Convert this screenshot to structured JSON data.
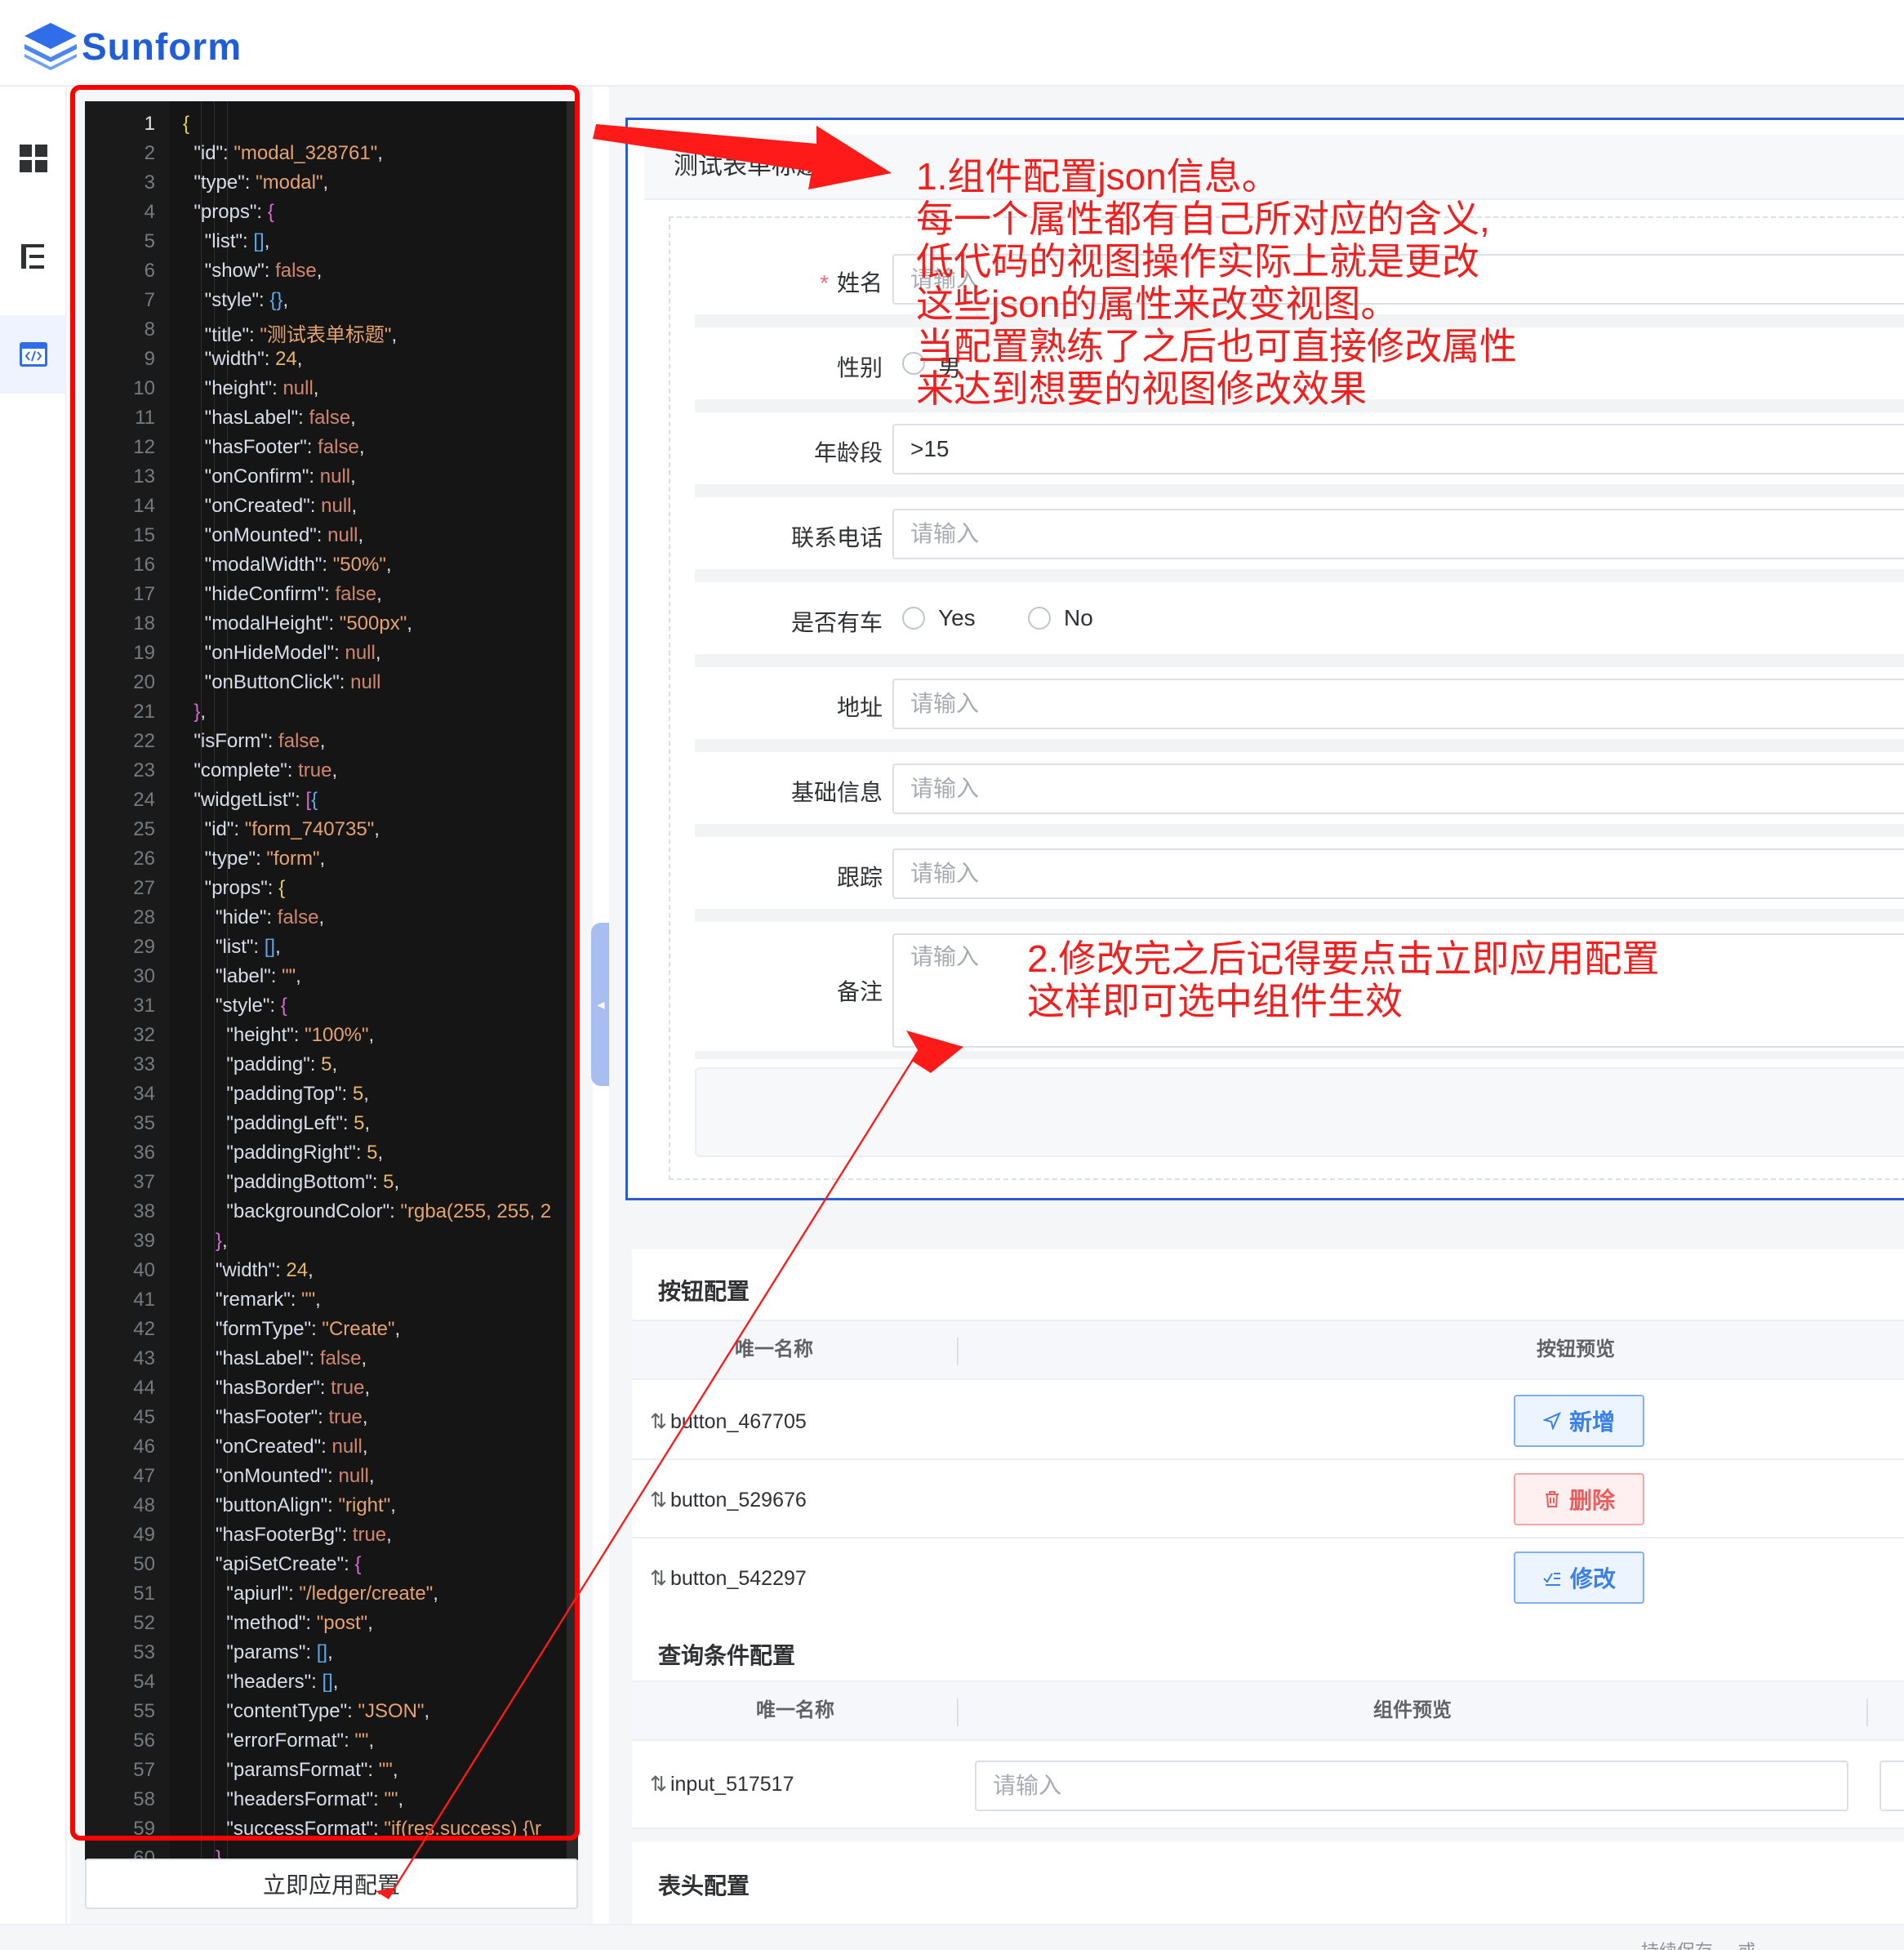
{
  "brand": {
    "name": "Sunform",
    "logo_icon": "layers-icon",
    "color": "#1f5ed8"
  },
  "nav": {
    "items": [
      {
        "icon": "dashboard-grid-icon",
        "active": false
      },
      {
        "icon": "tree-list-icon",
        "active": false
      },
      {
        "icon": "code-window-icon",
        "active": true
      }
    ]
  },
  "editor": {
    "apply_button": "立即应用配置",
    "current_line": 1,
    "lines": [
      [
        [
          "p1",
          "{"
        ]
      ],
      [
        [
          "k",
          "  \"id\": "
        ],
        [
          "s",
          "\"modal_328761\""
        ],
        [
          "k",
          ","
        ]
      ],
      [
        [
          "k",
          "  \"type\": "
        ],
        [
          "s",
          "\"modal\""
        ],
        [
          "k",
          ","
        ]
      ],
      [
        [
          "k",
          "  \"props\": "
        ],
        [
          "p2",
          "{"
        ]
      ],
      [
        [
          "k",
          "    \"list\": "
        ],
        [
          "p3",
          "[]"
        ],
        [
          "k",
          ","
        ]
      ],
      [
        [
          "k",
          "    \"show\": "
        ],
        [
          "b",
          "false"
        ],
        [
          "k",
          ","
        ]
      ],
      [
        [
          "k",
          "    \"style\": "
        ],
        [
          "p3",
          "{}"
        ],
        [
          "k",
          ","
        ]
      ],
      [
        [
          "k",
          "    \"title\": "
        ],
        [
          "s",
          "\"测试表单标题\""
        ],
        [
          "k",
          ","
        ]
      ],
      [
        [
          "k",
          "    \"width\": "
        ],
        [
          "n",
          "24"
        ],
        [
          "k",
          ","
        ]
      ],
      [
        [
          "k",
          "    \"height\": "
        ],
        [
          "b",
          "null"
        ],
        [
          "k",
          ","
        ]
      ],
      [
        [
          "k",
          "    \"hasLabel\": "
        ],
        [
          "b",
          "false"
        ],
        [
          "k",
          ","
        ]
      ],
      [
        [
          "k",
          "    \"hasFooter\": "
        ],
        [
          "b",
          "false"
        ],
        [
          "k",
          ","
        ]
      ],
      [
        [
          "k",
          "    \"onConfirm\": "
        ],
        [
          "b",
          "null"
        ],
        [
          "k",
          ","
        ]
      ],
      [
        [
          "k",
          "    \"onCreated\": "
        ],
        [
          "b",
          "null"
        ],
        [
          "k",
          ","
        ]
      ],
      [
        [
          "k",
          "    \"onMounted\": "
        ],
        [
          "b",
          "null"
        ],
        [
          "k",
          ","
        ]
      ],
      [
        [
          "k",
          "    \"modalWidth\": "
        ],
        [
          "s",
          "\"50%\""
        ],
        [
          "k",
          ","
        ]
      ],
      [
        [
          "k",
          "    \"hideConfirm\": "
        ],
        [
          "b",
          "false"
        ],
        [
          "k",
          ","
        ]
      ],
      [
        [
          "k",
          "    \"modalHeight\": "
        ],
        [
          "s",
          "\"500px\""
        ],
        [
          "k",
          ","
        ]
      ],
      [
        [
          "k",
          "    \"onHideModel\": "
        ],
        [
          "b",
          "null"
        ],
        [
          "k",
          ","
        ]
      ],
      [
        [
          "k",
          "    \"onButtonClick\": "
        ],
        [
          "b",
          "null"
        ]
      ],
      [
        [
          "p2",
          "  }"
        ],
        [
          "k",
          ","
        ]
      ],
      [
        [
          "k",
          "  \"isForm\": "
        ],
        [
          "b",
          "false"
        ],
        [
          "k",
          ","
        ]
      ],
      [
        [
          "k",
          "  \"complete\": "
        ],
        [
          "b",
          "true"
        ],
        [
          "k",
          ","
        ]
      ],
      [
        [
          "k",
          "  \"widgetList\": "
        ],
        [
          "p2",
          "["
        ],
        [
          "p3",
          "{"
        ]
      ],
      [
        [
          "k",
          "    \"id\": "
        ],
        [
          "s",
          "\"form_740735\""
        ],
        [
          "k",
          ","
        ]
      ],
      [
        [
          "k",
          "    \"type\": "
        ],
        [
          "s",
          "\"form\""
        ],
        [
          "k",
          ","
        ]
      ],
      [
        [
          "k",
          "    \"props\": "
        ],
        [
          "p1",
          "{"
        ]
      ],
      [
        [
          "k",
          "      \"hide\": "
        ],
        [
          "b",
          "false"
        ],
        [
          "k",
          ","
        ]
      ],
      [
        [
          "k",
          "      \"list\": "
        ],
        [
          "p3",
          "[]"
        ],
        [
          "k",
          ","
        ]
      ],
      [
        [
          "k",
          "      \"label\": "
        ],
        [
          "s",
          "\"\""
        ],
        [
          "k",
          ","
        ]
      ],
      [
        [
          "k",
          "      \"style\": "
        ],
        [
          "p2",
          "{"
        ]
      ],
      [
        [
          "k",
          "        \"height\": "
        ],
        [
          "s",
          "\"100%\""
        ],
        [
          "k",
          ","
        ]
      ],
      [
        [
          "k",
          "        \"padding\": "
        ],
        [
          "n",
          "5"
        ],
        [
          "k",
          ","
        ]
      ],
      [
        [
          "k",
          "        \"paddingTop\": "
        ],
        [
          "n",
          "5"
        ],
        [
          "k",
          ","
        ]
      ],
      [
        [
          "k",
          "        \"paddingLeft\": "
        ],
        [
          "n",
          "5"
        ],
        [
          "k",
          ","
        ]
      ],
      [
        [
          "k",
          "        \"paddingRight\": "
        ],
        [
          "n",
          "5"
        ],
        [
          "k",
          ","
        ]
      ],
      [
        [
          "k",
          "        \"paddingBottom\": "
        ],
        [
          "n",
          "5"
        ],
        [
          "k",
          ","
        ]
      ],
      [
        [
          "k",
          "        \"backgroundColor\": "
        ],
        [
          "s",
          "\"rgba(255, 255, 2"
        ]
      ],
      [
        [
          "p2",
          "      }"
        ],
        [
          "k",
          ","
        ]
      ],
      [
        [
          "k",
          "      \"width\": "
        ],
        [
          "n",
          "24"
        ],
        [
          "k",
          ","
        ]
      ],
      [
        [
          "k",
          "      \"remark\": "
        ],
        [
          "s",
          "\"\""
        ],
        [
          "k",
          ","
        ]
      ],
      [
        [
          "k",
          "      \"formType\": "
        ],
        [
          "s",
          "\"Create\""
        ],
        [
          "k",
          ","
        ]
      ],
      [
        [
          "k",
          "      \"hasLabel\": "
        ],
        [
          "b",
          "false"
        ],
        [
          "k",
          ","
        ]
      ],
      [
        [
          "k",
          "      \"hasBorder\": "
        ],
        [
          "b",
          "true"
        ],
        [
          "k",
          ","
        ]
      ],
      [
        [
          "k",
          "      \"hasFooter\": "
        ],
        [
          "b",
          "true"
        ],
        [
          "k",
          ","
        ]
      ],
      [
        [
          "k",
          "      \"onCreated\": "
        ],
        [
          "b",
          "null"
        ],
        [
          "k",
          ","
        ]
      ],
      [
        [
          "k",
          "      \"onMounted\": "
        ],
        [
          "b",
          "null"
        ],
        [
          "k",
          ","
        ]
      ],
      [
        [
          "k",
          "      \"buttonAlign\": "
        ],
        [
          "s",
          "\"right\""
        ],
        [
          "k",
          ","
        ]
      ],
      [
        [
          "k",
          "      \"hasFooterBg\": "
        ],
        [
          "b",
          "true"
        ],
        [
          "k",
          ","
        ]
      ],
      [
        [
          "k",
          "      \"apiSetCreate\": "
        ],
        [
          "p2",
          "{"
        ]
      ],
      [
        [
          "k",
          "        \"apiurl\": "
        ],
        [
          "s",
          "\"/ledger/create\""
        ],
        [
          "k",
          ","
        ]
      ],
      [
        [
          "k",
          "        \"method\": "
        ],
        [
          "s",
          "\"post\""
        ],
        [
          "k",
          ","
        ]
      ],
      [
        [
          "k",
          "        \"params\": "
        ],
        [
          "p3",
          "[]"
        ],
        [
          "k",
          ","
        ]
      ],
      [
        [
          "k",
          "        \"headers\": "
        ],
        [
          "p3",
          "[]"
        ],
        [
          "k",
          ","
        ]
      ],
      [
        [
          "k",
          "        \"contentType\": "
        ],
        [
          "s",
          "\"JSON\""
        ],
        [
          "k",
          ","
        ]
      ],
      [
        [
          "k",
          "        \"errorFormat\": "
        ],
        [
          "s",
          "\"\""
        ],
        [
          "k",
          ","
        ]
      ],
      [
        [
          "k",
          "        \"paramsFormat\": "
        ],
        [
          "s",
          "\"\""
        ],
        [
          "k",
          ","
        ]
      ],
      [
        [
          "k",
          "        \"headersFormat\": "
        ],
        [
          "s",
          "\"\""
        ],
        [
          "k",
          ","
        ]
      ],
      [
        [
          "k",
          "        \"successFormat\": "
        ],
        [
          "s",
          "\"if(res.success) {\\r"
        ]
      ],
      [
        [
          "p2",
          "      }"
        ]
      ]
    ]
  },
  "preview": {
    "modal_title": "测试表单标题",
    "fields": [
      {
        "label": "姓名",
        "required": true,
        "kind": "input",
        "placeholder": "请输入",
        "value": ""
      },
      {
        "label": "性别",
        "required": false,
        "kind": "radio",
        "options": [
          "男"
        ]
      },
      {
        "label": "年龄段",
        "required": false,
        "kind": "input",
        "placeholder": "",
        "value": ">15"
      },
      {
        "label": "联系电话",
        "required": false,
        "kind": "input",
        "placeholder": "请输入",
        "value": ""
      },
      {
        "label": "是否有车",
        "required": false,
        "kind": "radio",
        "options": [
          "Yes",
          "No"
        ]
      },
      {
        "label": "地址",
        "required": false,
        "kind": "input",
        "placeholder": "请输入",
        "value": ""
      },
      {
        "label": "基础信息",
        "required": false,
        "kind": "input",
        "placeholder": "请输入",
        "value": ""
      },
      {
        "label": "跟踪",
        "required": false,
        "kind": "input",
        "placeholder": "请输入",
        "value": ""
      },
      {
        "label": "备注",
        "required": false,
        "kind": "textarea",
        "placeholder": "请输入",
        "value": ""
      }
    ]
  },
  "button_config": {
    "title": "按钮配置",
    "headers": [
      "唯一名称",
      "按钮预览"
    ],
    "rows": [
      {
        "name": "button_467705",
        "button": "新增",
        "variant": "blue",
        "icon": "send-icon"
      },
      {
        "name": "button_529676",
        "button": "删除",
        "variant": "red",
        "icon": "trash-icon"
      },
      {
        "name": "button_542297",
        "button": "修改",
        "variant": "blue",
        "icon": "edit-list-icon"
      }
    ]
  },
  "query_config": {
    "title": "查询条件配置",
    "headers": [
      "唯一名称",
      "组件预览"
    ],
    "rows": [
      {
        "name": "input_517517",
        "placeholder": "请输入"
      }
    ]
  },
  "header_config": {
    "title": "表头配置"
  },
  "footer": {
    "text": "持续保存 ... 或"
  },
  "annotations": {
    "note1": [
      "1.组件配置json信息。",
      "每一个属性都有自己所对应的含义,",
      "低代码的视图操作实际上就是更改",
      "这些json的属性来改变视图。",
      "当配置熟练了之后也可直接修改属性",
      "来达到想要的视图修改效果"
    ],
    "note2": [
      "2.修改完之后记得要点击立即应用配置",
      "这样即可选中组件生效"
    ],
    "color": "#f21f1f"
  }
}
